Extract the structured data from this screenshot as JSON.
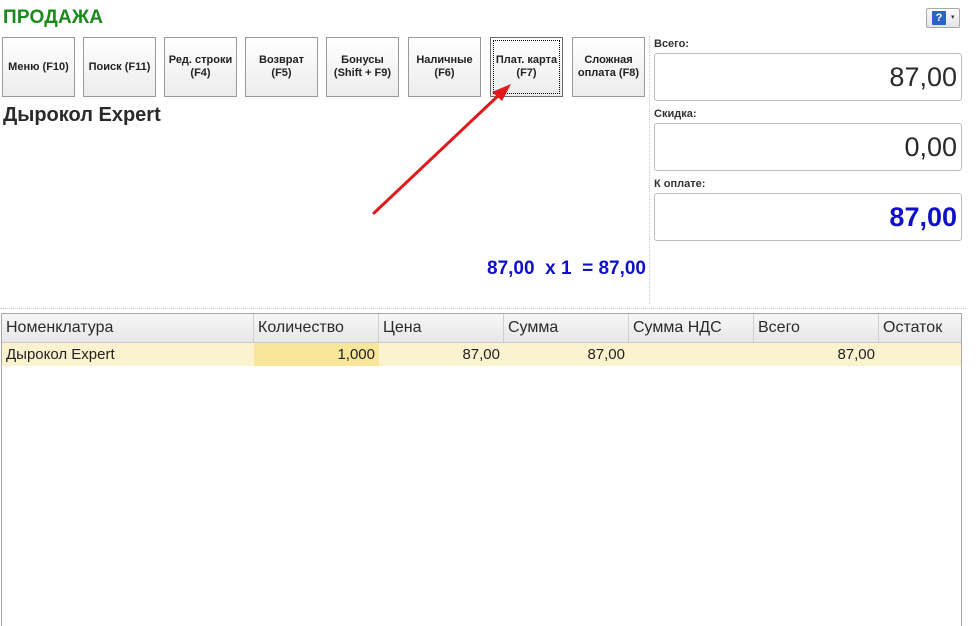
{
  "title": "ПРОДАЖА",
  "help": {
    "glyph": "?",
    "chevron": "▾"
  },
  "buttons": [
    {
      "label": "Меню (F10)"
    },
    {
      "label": "Поиск (F11)"
    },
    {
      "label": "Ред. строки\n(F4)"
    },
    {
      "label": "Возврат\n(F5)"
    },
    {
      "label": "Бонусы\n(Shift + F9)"
    },
    {
      "label": "Наличные\n(F6)"
    },
    {
      "label": "Плат. карта\n(F7)"
    },
    {
      "label": "Сложная\nоплата (F8)"
    }
  ],
  "product": {
    "name": "Дырокол Expert"
  },
  "calc": {
    "text": "87,00  x 1  = 87,00"
  },
  "totals": {
    "total_label": "Всего:",
    "total_value": "87,00",
    "discount_label": "Скидка:",
    "discount_value": "0,00",
    "pay_label": "К оплате:",
    "pay_value": "87,00"
  },
  "table": {
    "headers": [
      "Номенклатура",
      "Количество",
      "Цена",
      "Сумма",
      "Сумма НДС",
      "Всего",
      "Остаток"
    ],
    "rows": [
      [
        "Дырокол Expert",
        "1,000",
        "87,00",
        "87,00",
        "",
        "87,00",
        ""
      ]
    ]
  },
  "colors": {
    "title": "#1a8a1a",
    "accent_blue": "#1010c8",
    "arrow": "#e01a1a",
    "row_highlight": "#fbf3cf"
  }
}
